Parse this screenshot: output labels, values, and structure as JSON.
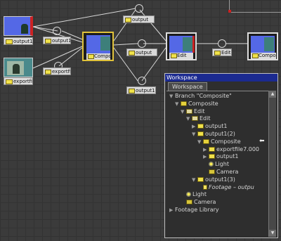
{
  "graph": {
    "nodes": [
      {
        "id": "n1",
        "label": "output1",
        "thumb": "blue"
      },
      {
        "id": "n2",
        "label": "exportfi",
        "thumb": "teal"
      },
      {
        "id": "n3",
        "label": "Compo",
        "thumb": "teal"
      },
      {
        "id": "n4",
        "label": "Edit",
        "thumb": "teal"
      },
      {
        "id": "n5",
        "label": "Compo",
        "thumb": "teal"
      }
    ],
    "out_labels": {
      "o1": "output1",
      "o2": "exportfi",
      "o3": "output1",
      "o4": "output",
      "o5": "output",
      "o6": "output1",
      "o7": "Edit"
    }
  },
  "workspace": {
    "title": "Workspace",
    "tab": "Workspace",
    "tree": [
      {
        "depth": 0,
        "arrow": "▼",
        "icon": "",
        "text": "Branch \"Composite\""
      },
      {
        "depth": 1,
        "arrow": "▼",
        "icon": "comp",
        "text": "Composite"
      },
      {
        "depth": 2,
        "arrow": "▼",
        "icon": "edit",
        "text": "Edit"
      },
      {
        "depth": 3,
        "arrow": "▼",
        "icon": "edit",
        "text": "Edit"
      },
      {
        "depth": 4,
        "arrow": "▶",
        "icon": "out",
        "text": "output1"
      },
      {
        "depth": 4,
        "arrow": "▼",
        "icon": "out",
        "text": "output1(2)"
      },
      {
        "depth": 5,
        "arrow": "▼",
        "icon": "comp",
        "text": "Composite"
      },
      {
        "depth": 6,
        "arrow": "▶",
        "icon": "out",
        "text": "exportfile7.000"
      },
      {
        "depth": 6,
        "arrow": "▶",
        "icon": "out",
        "text": "output1"
      },
      {
        "depth": 6,
        "arrow": "",
        "icon": "light",
        "text": "Light"
      },
      {
        "depth": 6,
        "arrow": "",
        "icon": "cam",
        "text": "Camera"
      },
      {
        "depth": 4,
        "arrow": "▼",
        "icon": "out",
        "text": "output1(3)"
      },
      {
        "depth": 5,
        "arrow": "",
        "icon": "foot",
        "text": "Footage – outpu",
        "italic": true
      },
      {
        "depth": 2,
        "arrow": "",
        "icon": "light",
        "text": "Light"
      },
      {
        "depth": 2,
        "arrow": "",
        "icon": "cam",
        "text": "Camera"
      },
      {
        "depth": 0,
        "arrow": "▶",
        "icon": "",
        "text": "Footage Library"
      }
    ]
  }
}
